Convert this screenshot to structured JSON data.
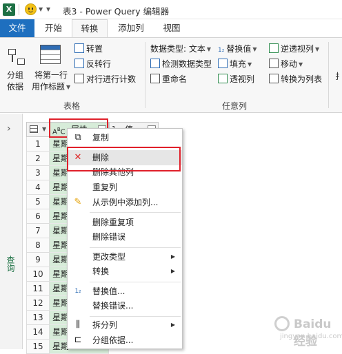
{
  "titlebar": {
    "app_icon": "excel-icon",
    "window_title": "表3 - Power Query 编辑器"
  },
  "tabs": {
    "file": "文件",
    "home": "开始",
    "transform": "转换",
    "add_column": "添加列",
    "view": "视图"
  },
  "ribbon": {
    "table_group": {
      "group_by": [
        "分组",
        "依据"
      ],
      "use_first_row": [
        "将第一行",
        "用作标题"
      ],
      "transpose": "转置",
      "reverse_rows": "反转行",
      "count_rows": "对行进行计数",
      "label": "表格"
    },
    "any_column_group": {
      "data_type": "数据类型: 文本",
      "detect_type": "检测数据类型",
      "rename": "重命名",
      "replace_values": "替换值",
      "fill": "填充",
      "pivot": "透视列",
      "unpivot": "逆透视列",
      "move": "移动",
      "to_list": "转换为列表",
      "label": "任意列"
    }
  },
  "left_panel": {
    "collapse": "›",
    "label": "查询"
  },
  "grid": {
    "columns": [
      "属性",
      "值"
    ],
    "rows": [
      {
        "num": "1",
        "attr": "星期"
      },
      {
        "num": "2",
        "attr": "星期"
      },
      {
        "num": "3",
        "attr": "星期"
      },
      {
        "num": "4",
        "attr": "星期"
      },
      {
        "num": "5",
        "attr": "星期"
      },
      {
        "num": "6",
        "attr": "星期"
      },
      {
        "num": "7",
        "attr": "星期"
      },
      {
        "num": "8",
        "attr": "星期"
      },
      {
        "num": "9",
        "attr": "星期"
      },
      {
        "num": "10",
        "attr": "星期"
      },
      {
        "num": "11",
        "attr": "星期"
      },
      {
        "num": "12",
        "attr": "星期"
      },
      {
        "num": "13",
        "attr": "星期"
      },
      {
        "num": "14",
        "attr": "星期"
      },
      {
        "num": "15",
        "attr": "星期"
      }
    ]
  },
  "context_menu": {
    "copy": "复制",
    "delete": "删除",
    "delete_others": "删除其他列",
    "duplicate": "重复列",
    "add_from_example": "从示例中添加列...",
    "remove_duplicates": "删除重复项",
    "remove_errors": "删除错误",
    "change_type": "更改类型",
    "transform": "转换",
    "replace_values": "替换值...",
    "replace_errors": "替换错误...",
    "split_column": "拆分列",
    "group_by": "分组依据..."
  },
  "watermark": {
    "text": "Baidu 经验",
    "url": "jingyan.baidu.com"
  }
}
